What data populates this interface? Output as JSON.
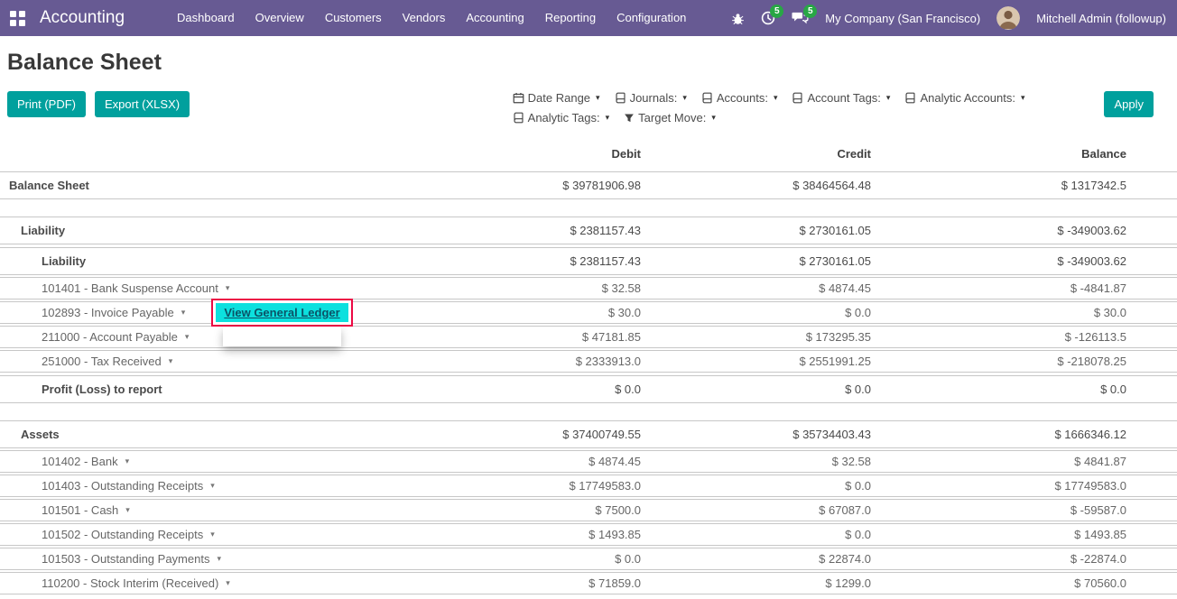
{
  "topbar": {
    "app_name": "Accounting",
    "menu": [
      "Dashboard",
      "Overview",
      "Customers",
      "Vendors",
      "Accounting",
      "Reporting",
      "Configuration"
    ],
    "activity_badge": "5",
    "message_badge": "5",
    "company": "My Company (San Francisco)",
    "user": "Mitchell Admin (followup)"
  },
  "page": {
    "title": "Balance Sheet",
    "print_button": "Print (PDF)",
    "export_button": "Export (XLSX)",
    "apply_button": "Apply"
  },
  "filters": {
    "row1": [
      {
        "label": "Date Range",
        "icon": "calendar-icon"
      },
      {
        "label": "Journals:",
        "icon": "book-icon"
      },
      {
        "label": "Accounts:",
        "icon": "book-icon"
      },
      {
        "label": "Account Tags:",
        "icon": "book-icon"
      },
      {
        "label": "Analytic Accounts:",
        "icon": "book-icon"
      }
    ],
    "row2": [
      {
        "label": "Analytic Tags:",
        "icon": "book-icon"
      },
      {
        "label": "Target Move:",
        "icon": "filter-icon"
      }
    ]
  },
  "table": {
    "headers": {
      "debit": "Debit",
      "credit": "Credit",
      "balance": "Balance"
    },
    "rows": [
      {
        "label": "Balance Sheet",
        "debit": "$ 39781906.98",
        "credit": "$ 38464564.48",
        "balance": "$ 1317342.5",
        "level": 0,
        "bold": true
      },
      {
        "label": "Liability",
        "debit": "$ 2381157.43",
        "credit": "$ 2730161.05",
        "balance": "$ -349003.62",
        "level": 1,
        "bold": true,
        "section": true
      },
      {
        "label": "Liability",
        "debit": "$ 2381157.43",
        "credit": "$ 2730161.05",
        "balance": "$ -349003.62",
        "level": 2,
        "bold": true
      },
      {
        "label": "101401 - Bank Suspense Account",
        "debit": "$ 32.58",
        "credit": "$ 4874.45",
        "balance": "$ -4841.87",
        "level": 2,
        "caret": true
      },
      {
        "label": "102893 - Invoice Payable",
        "debit": "$ 30.0",
        "credit": "$ 0.0",
        "balance": "$ 30.0",
        "level": 2,
        "caret": true,
        "dropdown_open": true
      },
      {
        "label": "211000 - Account Payable",
        "debit": "$ 47181.85",
        "credit": "$ 173295.35",
        "balance": "$ -126113.5",
        "level": 2,
        "caret": true
      },
      {
        "label": "251000 - Tax Received",
        "debit": "$ 2333913.0",
        "credit": "$ 2551991.25",
        "balance": "$ -218078.25",
        "level": 2,
        "caret": true
      },
      {
        "label": "Profit (Loss) to report",
        "debit": "$ 0.0",
        "credit": "$ 0.0",
        "balance": "$ 0.0",
        "level": 2,
        "bold": true
      },
      {
        "label": "Assets",
        "debit": "$ 37400749.55",
        "credit": "$ 35734403.43",
        "balance": "$ 1666346.12",
        "level": 1,
        "bold": true,
        "section": true
      },
      {
        "label": "101402 - Bank",
        "debit": "$ 4874.45",
        "credit": "$ 32.58",
        "balance": "$ 4841.87",
        "level": 2,
        "caret": true
      },
      {
        "label": "101403 - Outstanding Receipts",
        "debit": "$ 17749583.0",
        "credit": "$ 0.0",
        "balance": "$ 17749583.0",
        "level": 2,
        "caret": true
      },
      {
        "label": "101501 - Cash",
        "debit": "$ 7500.0",
        "credit": "$ 67087.0",
        "balance": "$ -59587.0",
        "level": 2,
        "caret": true
      },
      {
        "label": "101502 - Outstanding Receipts",
        "debit": "$ 1493.85",
        "credit": "$ 0.0",
        "balance": "$ 1493.85",
        "level": 2,
        "caret": true
      },
      {
        "label": "101503 - Outstanding Payments",
        "debit": "$ 0.0",
        "credit": "$ 22874.0",
        "balance": "$ -22874.0",
        "level": 2,
        "caret": true
      },
      {
        "label": "110200 - Stock Interim (Received)",
        "debit": "$ 71859.0",
        "credit": "$ 1299.0",
        "balance": "$ 70560.0",
        "level": 2,
        "caret": true
      }
    ]
  },
  "dropdown": {
    "items": [
      "View General Ledger"
    ]
  },
  "colors": {
    "topbar": "#675a93",
    "accent": "#00a09d",
    "badge": "#28a745",
    "highlight": "#0ce0de",
    "annotation": "#ec0944"
  }
}
